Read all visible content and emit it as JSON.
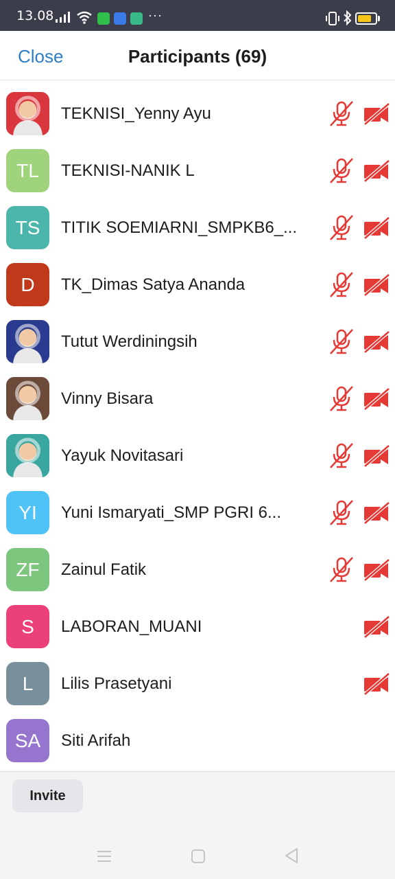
{
  "status_bar": {
    "time": "13.08",
    "dots": "···",
    "icons": [
      "signal-icon",
      "wifi-icon",
      "whatsapp-icon",
      "app-icon",
      "app-icon",
      "vibrate-icon",
      "bluetooth-icon",
      "battery-icon"
    ],
    "battery_level": 0.8,
    "battery_color": "#f5c518"
  },
  "header": {
    "close_label": "Close",
    "title": "Participants (69)"
  },
  "participants": [
    {
      "name": "TEKNISI_Yenny Ayu",
      "initials": "",
      "avatar_color": "#d9363e",
      "avatar_type": "photo",
      "muted": true,
      "video_off": true
    },
    {
      "name": "TEKNISI-NANIK L",
      "initials": "TL",
      "avatar_color": "#9fd37c",
      "avatar_type": "initials",
      "muted": true,
      "video_off": true
    },
    {
      "name": "TITIK SOEMIARNI_SMPKB6_...",
      "initials": "TS",
      "avatar_color": "#4db6ac",
      "avatar_type": "initials",
      "muted": true,
      "video_off": true
    },
    {
      "name": "TK_Dimas Satya Ananda",
      "initials": "D",
      "avatar_color": "#c0391b",
      "avatar_type": "initials",
      "muted": true,
      "video_off": true
    },
    {
      "name": "Tutut Werdiningsih",
      "initials": "",
      "avatar_color": "#2a3b8f",
      "avatar_type": "photo",
      "muted": true,
      "video_off": true
    },
    {
      "name": "Vinny Bisara",
      "initials": "",
      "avatar_color": "#6b4a3a",
      "avatar_type": "photo",
      "muted": true,
      "video_off": true
    },
    {
      "name": "Yayuk Novitasari",
      "initials": "",
      "avatar_color": "#3aa6a0",
      "avatar_type": "photo",
      "muted": true,
      "video_off": true
    },
    {
      "name": "Yuni Ismaryati_SMP PGRI 6...",
      "initials": "YI",
      "avatar_color": "#4fc3f7",
      "avatar_type": "initials",
      "muted": true,
      "video_off": true
    },
    {
      "name": "Zainul Fatik",
      "initials": "ZF",
      "avatar_color": "#7dc67e",
      "avatar_type": "initials",
      "muted": true,
      "video_off": true
    },
    {
      "name": "LABORAN_MUANI",
      "initials": "S",
      "avatar_color": "#ec407a",
      "avatar_type": "initials",
      "muted": false,
      "video_off": true
    },
    {
      "name": "Lilis Prasetyani",
      "initials": "L",
      "avatar_color": "#78909c",
      "avatar_type": "initials",
      "muted": false,
      "video_off": true
    },
    {
      "name": "Siti Arifah",
      "initials": "SA",
      "avatar_color": "#9575cd",
      "avatar_type": "initials",
      "muted": false,
      "video_off": false
    }
  ],
  "colors": {
    "accent": "#2d7ec6",
    "muted_red": "#e53935"
  },
  "footer": {
    "invite_label": "Invite"
  },
  "nav_bar": {
    "icons": [
      "menu-icon",
      "home-icon",
      "back-icon"
    ]
  }
}
